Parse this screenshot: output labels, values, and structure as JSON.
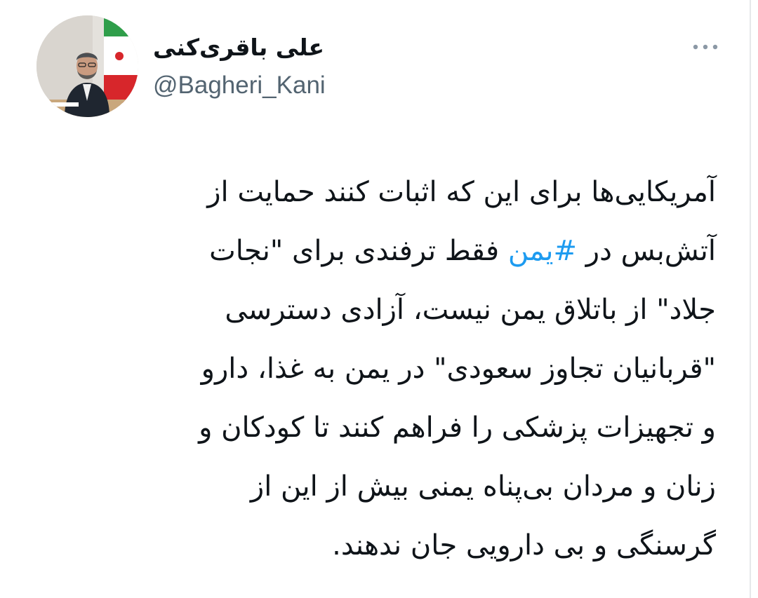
{
  "author": {
    "display_name": "علی باقری‌کنی",
    "handle": "@Bagheri_Kani",
    "avatar_icon": "profile-photo"
  },
  "menu": {
    "icon": "more-options-icon"
  },
  "colors": {
    "text": "#0f1419",
    "secondary": "#536471",
    "link": "#1d9bf0"
  },
  "tweet": {
    "line_1": "آمریکایی‌ها برای این که اثبات کنند حمایت از",
    "line_2_before": "آتش‌بس در ",
    "hashtag": "#یمن",
    "line_2_after": " فقط ترفندی برای \"نجات",
    "line_3": "جلاد\" از باتلاق یمن نیست، آزادی دسترسی",
    "line_4": "\"قربانیان تجاوز سعودی\" در یمن به غذا، دارو",
    "line_5": "و تجهیزات پزشکی را فراهم کنند تا کودکان و",
    "line_6": "زنان و مردان بی‌پناه یمنی بیش از این از",
    "line_7": "گرسنگی و بی دارویی جان ندهند."
  }
}
